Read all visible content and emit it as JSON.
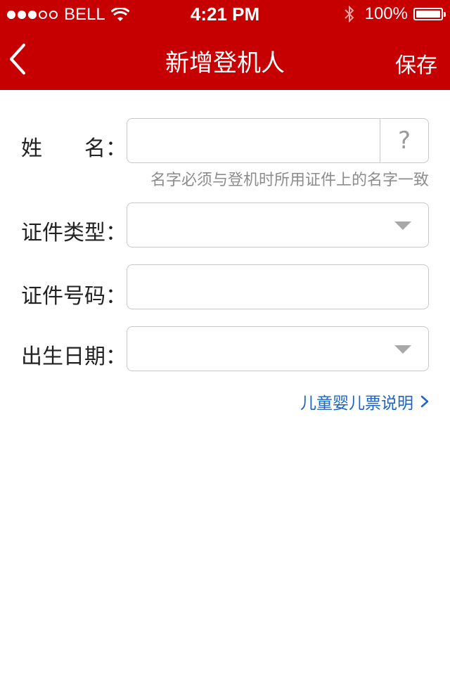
{
  "status_bar": {
    "carrier": "BELL",
    "time": "4:21 PM",
    "battery": "100%",
    "signal_bars": 5,
    "signal_filled": 3,
    "icons": [
      "wifi-icon",
      "bluetooth-icon",
      "battery-icon"
    ]
  },
  "nav": {
    "title": "新增登机人",
    "save_label": "保存",
    "back_icon": "chevron-left-icon"
  },
  "form": {
    "name": {
      "label": "姓　　名：",
      "value": "",
      "help": "?",
      "hint": "名字必须与登机时所用证件上的名字一致"
    },
    "id_type": {
      "label": "证件类型：",
      "value": ""
    },
    "id_number": {
      "label": "证件号码：",
      "value": ""
    },
    "birth_date": {
      "label": "出生日期：",
      "value": ""
    }
  },
  "link": {
    "label": "儿童婴儿票说明"
  },
  "colors": {
    "brand": "#c60000",
    "link": "#1a66c8",
    "hint": "#8c8c8c",
    "border": "#c9c9c9"
  }
}
